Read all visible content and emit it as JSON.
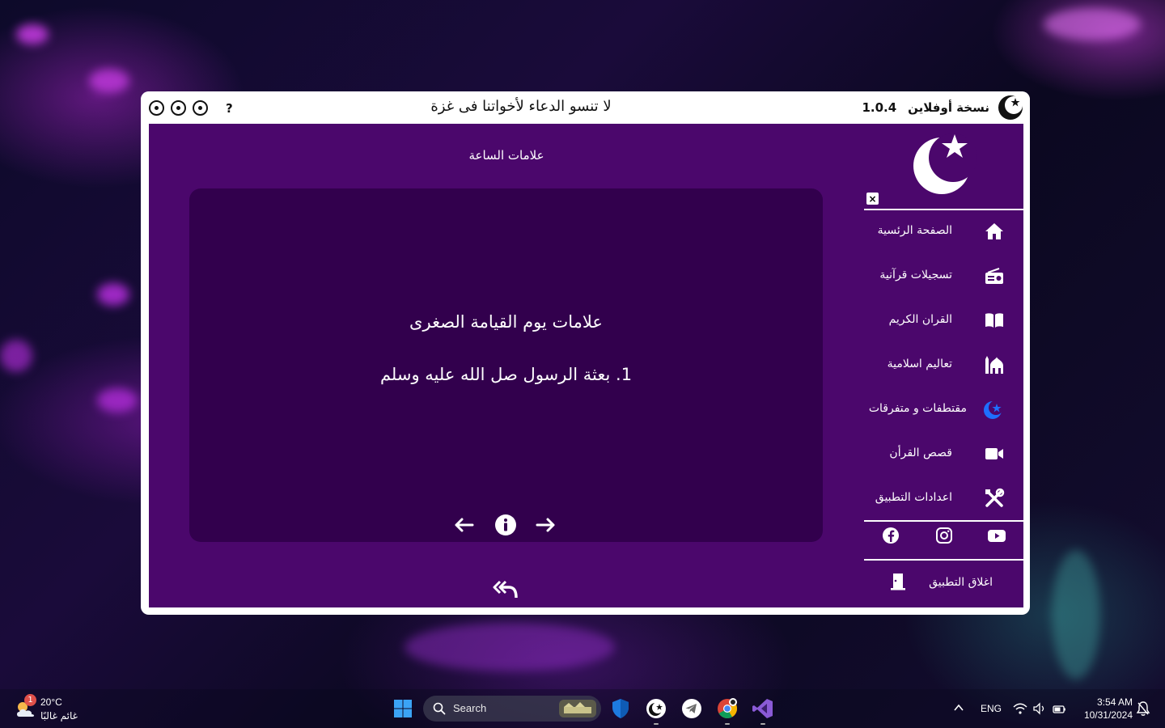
{
  "titlebar": {
    "help": "?",
    "marquee": "لا تنسو الدعاء لأخواتنا فى غزة",
    "version_label": "نسخة أوفلاين",
    "version_number": "1.0.4"
  },
  "main": {
    "section_title": "علامات الساعة",
    "card_heading": "علامات يوم القيامة الصغرى",
    "card_item": "1. بعثة الرسول صل الله عليه وسلم"
  },
  "sidebar": {
    "close": "×",
    "items": [
      {
        "label": "الصفحة الرئسية",
        "icon": "home-icon"
      },
      {
        "label": "تسجيلات قرآنية",
        "icon": "radio-icon"
      },
      {
        "label": "القران الكريم",
        "icon": "book-open-icon"
      },
      {
        "label": "تعاليم اسلامية",
        "icon": "mosque-icon"
      },
      {
        "label": "مقتطفات و متفرقات",
        "icon": "crescent-star-icon"
      },
      {
        "label": "قصص القرأن",
        "icon": "video-camera-icon"
      },
      {
        "label": "اعدادات التطبيق",
        "icon": "tools-icon"
      }
    ],
    "social": [
      "facebook-icon",
      "instagram-icon",
      "youtube-icon"
    ],
    "exit_label": "اغلاق التطبيق"
  },
  "taskbar": {
    "weather_badge": "1",
    "weather_temp": "20°C",
    "weather_condition": "غائم غالبًا",
    "search_placeholder": "Search",
    "language": "ENG",
    "time": "3:54 AM",
    "date": "10/31/2024"
  },
  "colors": {
    "app_purple": "#4b076c",
    "card_purple": "#32004d",
    "accent_blue": "#1e6fff"
  }
}
